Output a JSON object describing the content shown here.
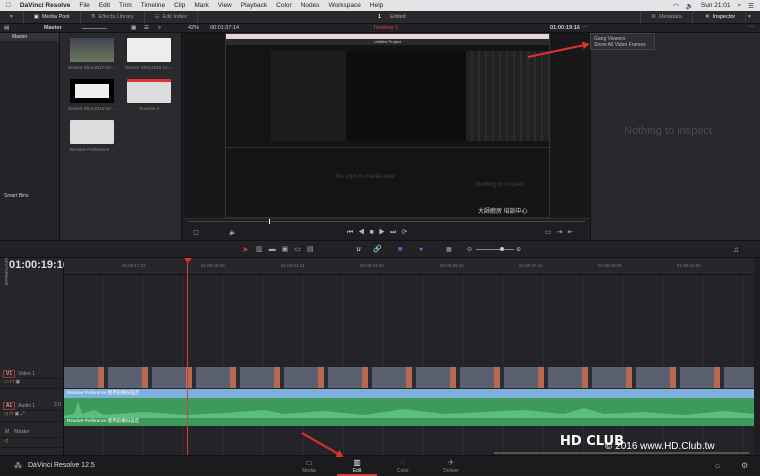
{
  "menubar": {
    "app": "DaVinci Resolve",
    "items": [
      "File",
      "Edit",
      "Trim",
      "Timeline",
      "Clip",
      "Mark",
      "View",
      "Playback",
      "Color",
      "Nodes",
      "Workspace",
      "Help"
    ],
    "clock": "Sun 21:01"
  },
  "toolbar": {
    "media_pool": "Media Pool",
    "effects_library": "Effects Library",
    "edit_index": "Edit Index",
    "timeline_count": "1",
    "status": "Edited",
    "metadata": "Metadata",
    "inspector": "Inspector"
  },
  "subbar": {
    "bin": "Master",
    "zoom": "42%",
    "source_tc": "00:01:37:14",
    "timeline_name": "Timeline 1",
    "record_tc": "01:00:19:16"
  },
  "sidebar": {
    "master": "Master",
    "smart_bins": "Smart Bins"
  },
  "pool": {
    "clips": [
      "Screen Shot 2017-01-...",
      "Screen Shot 2016-12-...",
      "Screen Shot 2016-12-...",
      "Timeline 1",
      "Resolve Preference ..."
    ]
  },
  "viewer_menu": {
    "items": [
      "Gang Viewers",
      "Show All Video Frames"
    ]
  },
  "inner": {
    "project": "Untitled Project",
    "empty_pool": "No clips in media pool",
    "nothing": "Nothing to inspect",
    "watermark": "大師廚房 培訓中心"
  },
  "inspector": {
    "empty": "Nothing to inspect"
  },
  "timeline": {
    "timecode": "01:00:19:16",
    "ticks": [
      "01:00:17:22",
      "01:00:19:24",
      "01:00:21:21",
      "01:00:23:18",
      "01:00:25:14",
      "01:00:27:11",
      "01:00:29:08",
      "01:00:31:05"
    ],
    "tracks": {
      "v1_badge": "V1",
      "v1_name": "Video 1",
      "a1_badge": "A1",
      "a1_name": "Audio 1",
      "a1_ch": "2.0",
      "master_badge": "M",
      "master_name": "Master"
    },
    "clip_name": "Resolve Preference 使用前備份設定",
    "side_label": "DEVTOPRANE"
  },
  "pages": {
    "media": "Media",
    "edit": "Edit",
    "color": "Color",
    "deliver": "Deliver",
    "active": "Edit"
  },
  "footer": {
    "app_version": "DaVinci Resolve 12.5",
    "copyright": "© 2016  www.HD.Club.tw",
    "logo": "HD CLUB"
  },
  "colors": {
    "accent_red": "#e0302a",
    "audio_clip": "#3e9a5c",
    "audio_header": "#7fb0dc",
    "timeline_title": "#d2403a"
  }
}
